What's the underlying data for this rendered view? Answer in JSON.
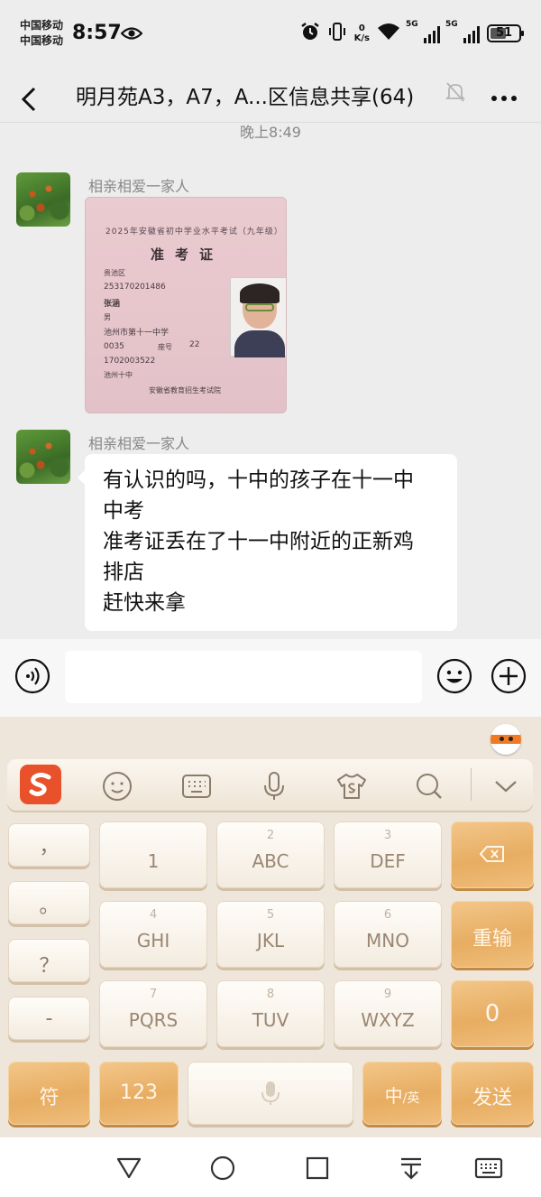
{
  "status_bar": {
    "carrier_1": "中国移动",
    "carrier_2": "中国移动",
    "time": "8:57",
    "net_speed_value": "0",
    "net_speed_unit": "K/s",
    "sim1_tag": "5G",
    "sim2_tag": "5G",
    "battery": "51"
  },
  "header": {
    "title": "明月苑A3，A7，A...区信息共享(64)"
  },
  "chat": {
    "timestamp": "晚上8:49",
    "messages": [
      {
        "sender": "相亲相爱一家人",
        "photo": {
          "heading": "2025年安徽省初中学业水平考试（九年级）",
          "title": "准考证",
          "lines": [
            "贵池区",
            "253170201486",
            "张涵",
            "男",
            "池州市第十一中学",
            "0035",
            "座号",
            "22",
            "1702003522",
            "池州十中"
          ],
          "issuer": "安徽省教育招生考试院"
        }
      },
      {
        "sender": "相亲相爱一家人",
        "text_lines": [
          "有认识的吗，十中的孩子在十一中",
          "中考",
          "准考证丢在了十一中附近的正新鸡",
          "排店",
          "赶快来拿"
        ]
      }
    ]
  },
  "keyboard": {
    "side_keys": [
      "，",
      "。",
      "？",
      "-"
    ],
    "keys": [
      {
        "num": "",
        "label": "1"
      },
      {
        "num": "2",
        "label": "ABC"
      },
      {
        "num": "3",
        "label": "DEF"
      },
      {
        "num": "4",
        "label": "GHI"
      },
      {
        "num": "5",
        "label": "JKL"
      },
      {
        "num": "6",
        "label": "MNO"
      },
      {
        "num": "7",
        "label": "PQRS"
      },
      {
        "num": "8",
        "label": "TUV"
      },
      {
        "num": "9",
        "label": "WXYZ"
      }
    ],
    "reinput": "重输",
    "zero": "0",
    "symbol": "符",
    "numbers": "123",
    "lang_main": "中",
    "lang_sub": "/英",
    "send": "发送"
  },
  "colors": {
    "accent_orange": "#e8512a",
    "wood_key": "#e7ad62",
    "chat_bg": "#ededed"
  }
}
